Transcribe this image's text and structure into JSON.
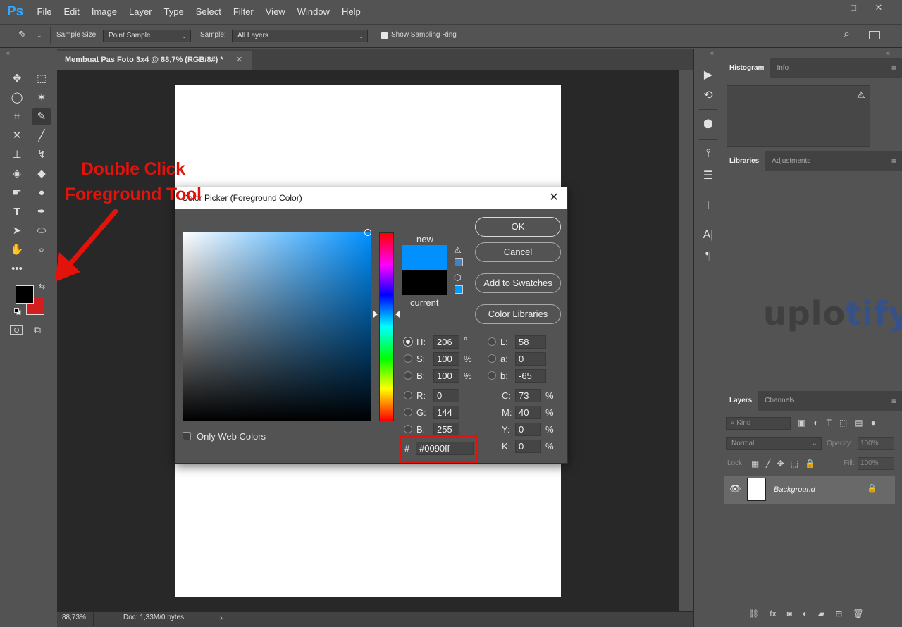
{
  "app": {
    "logo": "Ps"
  },
  "menu": [
    "File",
    "Edit",
    "Image",
    "Layer",
    "Type",
    "Select",
    "Filter",
    "View",
    "Window",
    "Help"
  ],
  "options": {
    "sample_size_label": "Sample Size:",
    "sample_size_value": "Point Sample",
    "sample_label": "Sample:",
    "sample_value": "All Layers",
    "show_ring_label": "Show Sampling Ring"
  },
  "document": {
    "tab_title": "Membuat Pas Foto 3x4 @ 88,7% (RGB/8#) *"
  },
  "status": {
    "zoom": "88,73%",
    "doc": "Doc: 1,33M/0 bytes"
  },
  "annotation": {
    "line1": "Double Click",
    "line2": "Foreground Tool"
  },
  "dialog": {
    "title": "Color Picker (Foreground Color)",
    "new_label": "new",
    "current_label": "current",
    "new_color": "#0090ff",
    "current_color": "#000000",
    "buttons": {
      "ok": "OK",
      "cancel": "Cancel",
      "swatches": "Add to Swatches",
      "libraries": "Color Libraries"
    },
    "only_web_label": "Only Web Colors",
    "hsb": {
      "h": "206",
      "s": "100",
      "b": "100",
      "h_unit": "°",
      "s_unit": "%",
      "b_unit": "%"
    },
    "rgb": {
      "r": "0",
      "g": "144",
      "b": "255"
    },
    "lab": {
      "l": "58",
      "a": "0",
      "b": "-65"
    },
    "cmyk": {
      "c": "73",
      "m": "40",
      "y": "0",
      "k": "0",
      "unit": "%"
    },
    "hex": "#0090ff",
    "labels": {
      "H": "H:",
      "S": "S:",
      "B": "B:",
      "R": "R:",
      "G": "G:",
      "Bl": "B:",
      "L": "L:",
      "a": "a:",
      "b": "b:",
      "C": "C:",
      "M": "M:",
      "Y": "Y:",
      "K": "K:",
      "hash": "#"
    }
  },
  "panels": {
    "histogram_tab": "Histogram",
    "info_tab": "Info",
    "libraries_tab": "Libraries",
    "adjustments_tab": "Adjustments",
    "layers_tab": "Layers",
    "channels_tab": "Channels",
    "kind_label": "Kind",
    "blend_mode": "Normal",
    "opacity_label": "Opacity:",
    "opacity_value": "100%",
    "lock_label": "Lock:",
    "fill_label": "Fill:",
    "fill_value": "100%",
    "layer_name": "Background"
  },
  "watermark": {
    "part1": "uplo",
    "part2": "tify"
  },
  "colors": {
    "foreground": "#000000",
    "background": "#d21e1e",
    "accent": "#0090ff",
    "highlight": "#e3120b"
  }
}
